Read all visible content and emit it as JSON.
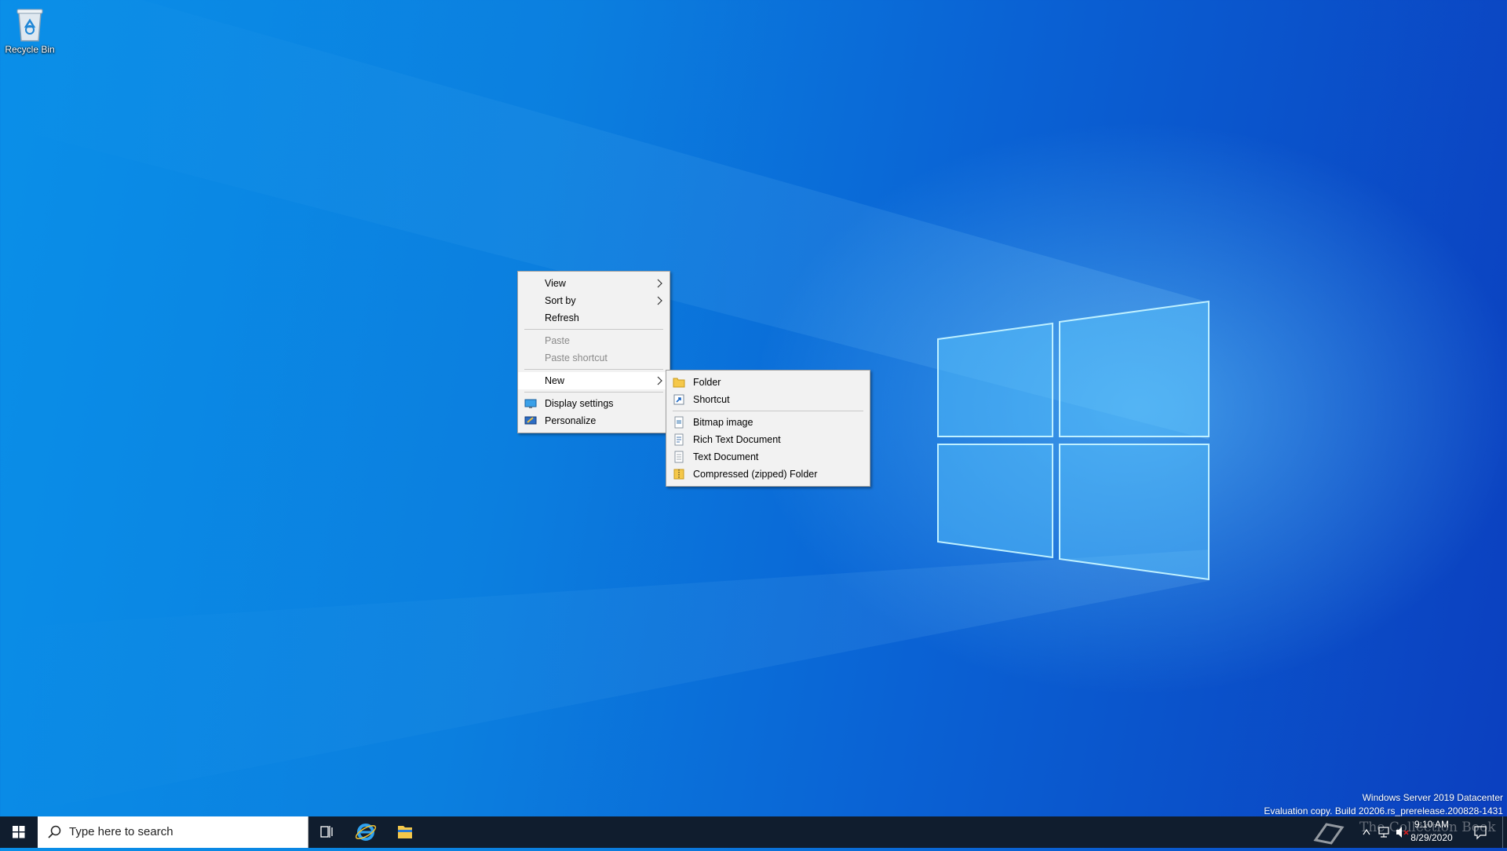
{
  "desktop": {
    "icons": [
      {
        "label": "Recycle Bin",
        "icon": "recycle-bin-icon"
      }
    ],
    "watermark": {
      "line1": "Windows Server 2019 Datacenter",
      "line2": "Evaluation copy. Build 20206.rs_prerelease.200828-1431"
    }
  },
  "context_menu": {
    "items": [
      {
        "label": "View",
        "submenu": true
      },
      {
        "label": "Sort by",
        "submenu": true
      },
      {
        "label": "Refresh"
      },
      {
        "label": "Paste",
        "disabled": true
      },
      {
        "label": "Paste shortcut",
        "disabled": true
      },
      {
        "label": "New",
        "submenu": true,
        "highlighted": true
      },
      {
        "label": "Display settings",
        "icon": "display-settings-icon"
      },
      {
        "label": "Personalize",
        "icon": "personalize-icon"
      }
    ]
  },
  "new_submenu": {
    "items": [
      {
        "label": "Folder",
        "icon": "folder-icon"
      },
      {
        "label": "Shortcut",
        "icon": "shortcut-icon"
      },
      {
        "label": "Bitmap image",
        "icon": "bitmap-image-icon"
      },
      {
        "label": "Rich Text Document",
        "icon": "rich-text-document-icon"
      },
      {
        "label": "Text Document",
        "icon": "text-document-icon"
      },
      {
        "label": "Compressed (zipped) Folder",
        "icon": "zip-folder-icon"
      }
    ]
  },
  "taskbar": {
    "search_placeholder": "Type here to search",
    "pinned": [
      "task-view-icon",
      "internet-explorer-icon",
      "file-explorer-icon"
    ],
    "overlay_text": "The Collection Book",
    "clock": {
      "time": "9:10 AM",
      "date": "8/29/2020"
    }
  },
  "colors": {
    "taskbar": "#101d2e",
    "desktop_accent": "#0b7fdf",
    "menu_bg": "#f2f2f2"
  }
}
